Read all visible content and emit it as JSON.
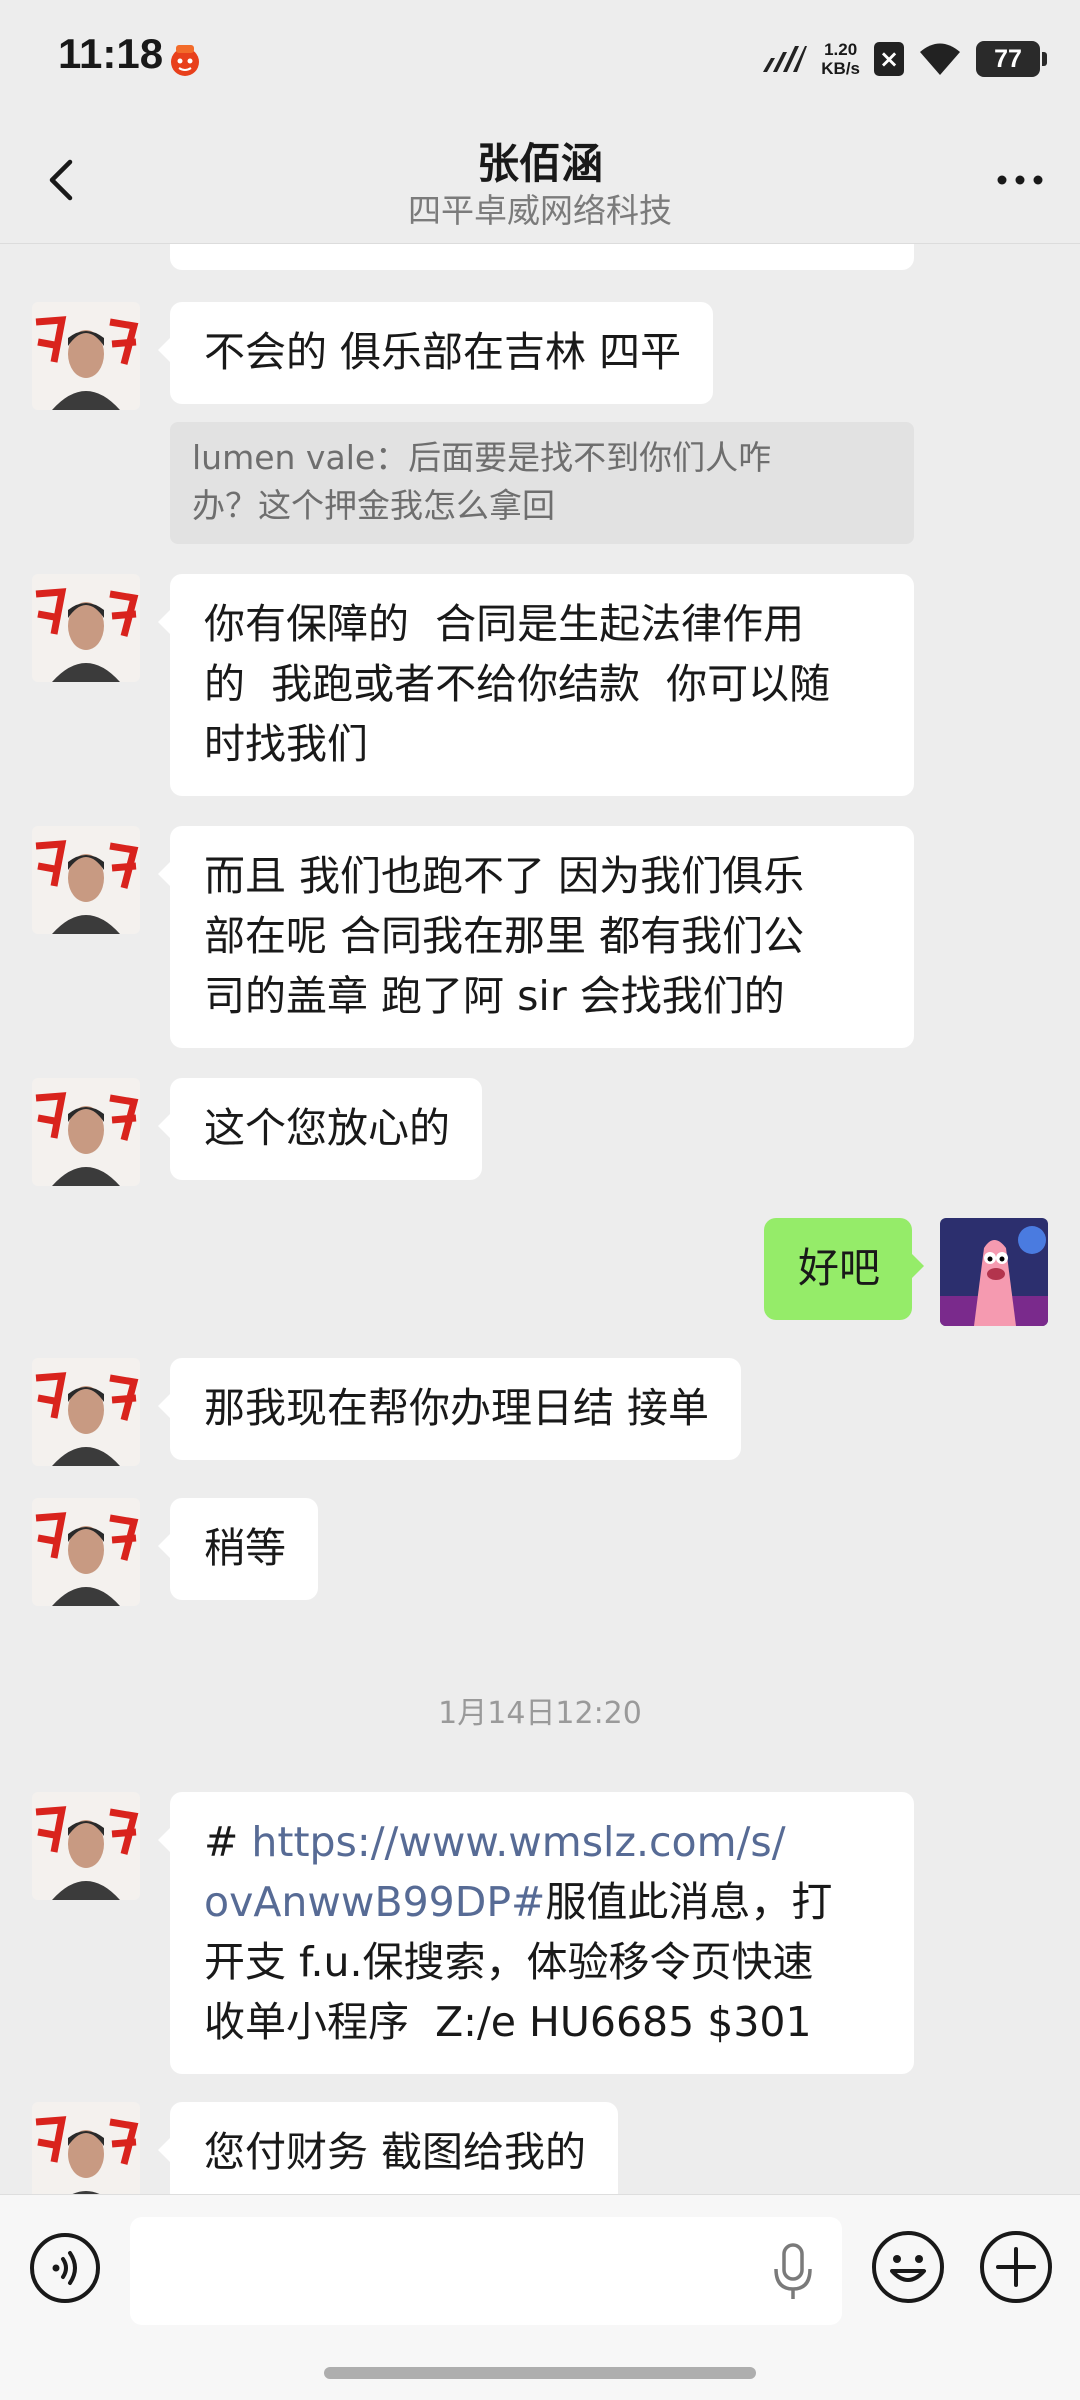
{
  "status_bar": {
    "time": "11:18",
    "speed_value": "1.20",
    "speed_unit": "KB/s",
    "battery": "77",
    "icons": [
      "app-notification-icon",
      "cellular-signal-icon",
      "no-sim-icon",
      "wifi-icon",
      "battery-icon"
    ]
  },
  "header": {
    "title": "张佰涵",
    "subtitle": "四平卓威网络科技",
    "back_icon": "chevron-left-icon",
    "more_icon": "more-dots-icon"
  },
  "messages": [
    {
      "side": "left",
      "text": "不会的 俱乐部在吉林 四平"
    },
    {
      "side": "left",
      "quote": "lumen vale：后面要是找不到你们人咋\n办？这个押金我怎么拿回"
    },
    {
      "side": "left",
      "text": "你有保障的  合同是生起法律作用\n的  我跑或者不给你结款  你可以随\n时找我们"
    },
    {
      "side": "left",
      "text": "而且 我们也跑不了 因为我们俱乐\n部在呢 合同我在那里 都有我们公\n司的盖章 跑了阿 sir 会找我们的"
    },
    {
      "side": "left",
      "text": "这个您放心的"
    },
    {
      "side": "right",
      "text": "好吧"
    },
    {
      "side": "left",
      "text": "那我现在帮你办理日结 接单"
    },
    {
      "side": "left",
      "text": "稍等"
    },
    {
      "side": "left",
      "text_prefix": "# ",
      "link": "https://www.wmslz.com/s/\novAnwwB99DP#",
      "text_suffix": "服值此消息，打\n开支 f.u.保搜索，体验移令页快速\n收单小程序  Z:/e HU6685 $301"
    },
    {
      "side": "left",
      "text": "您付财务 截图给我的"
    }
  ],
  "timestamp": "1月14日12:20",
  "input_bar": {
    "placeholder": "",
    "icons": [
      "voice-icon",
      "microphone-icon",
      "emoji-icon",
      "plus-icon"
    ]
  },
  "colors": {
    "background": "#ededed",
    "bubble_self": "#95ec69",
    "bubble_other": "#ffffff",
    "link": "#576b95",
    "quote_bg": "#e2e2e2"
  }
}
